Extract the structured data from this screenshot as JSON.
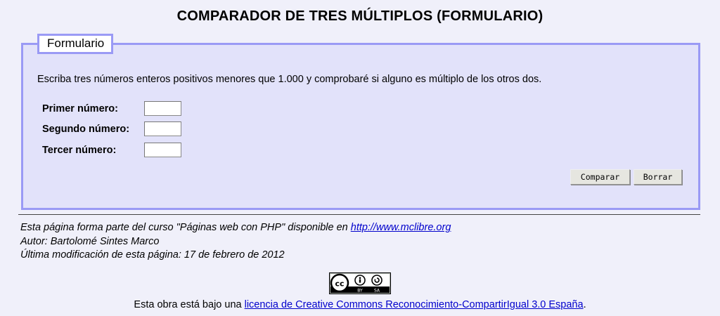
{
  "page": {
    "title": "COMPARADOR DE TRES MÚLTIPLOS (FORMULARIO)"
  },
  "form": {
    "legend": "Formulario",
    "intro": "Escriba tres números enteros positivos menores que 1.000 y comprobaré si alguno es múltiplo de los otros dos.",
    "fields": [
      {
        "label": "Primer número:",
        "value": ""
      },
      {
        "label": "Segundo número:",
        "value": ""
      },
      {
        "label": "Tercer número:",
        "value": ""
      }
    ],
    "submit_label": "Comparar",
    "reset_label": "Borrar"
  },
  "footer": {
    "course_text": "Esta página forma parte del curso \"Páginas web con PHP\" disponible en ",
    "course_link": "http://www.mclibre.org",
    "author": "Autor: Bartolomé Sintes Marco",
    "modified": "Última modificación de esta página: 17 de febrero de 2012",
    "license_prefix": "Esta obra está bajo una ",
    "license_link": "licencia de Creative Commons Reconocimiento-CompartirIgual 3.0 España",
    "license_suffix": ".",
    "badge": {
      "by": "BY",
      "sa": "SA",
      "icon": "creative-commons-badge"
    }
  },
  "colors": {
    "page_bg": "#f0f0fa",
    "fieldset_bg": "#e2e2fa",
    "fieldset_border": "#9a9af5",
    "link": "#0000cc"
  }
}
